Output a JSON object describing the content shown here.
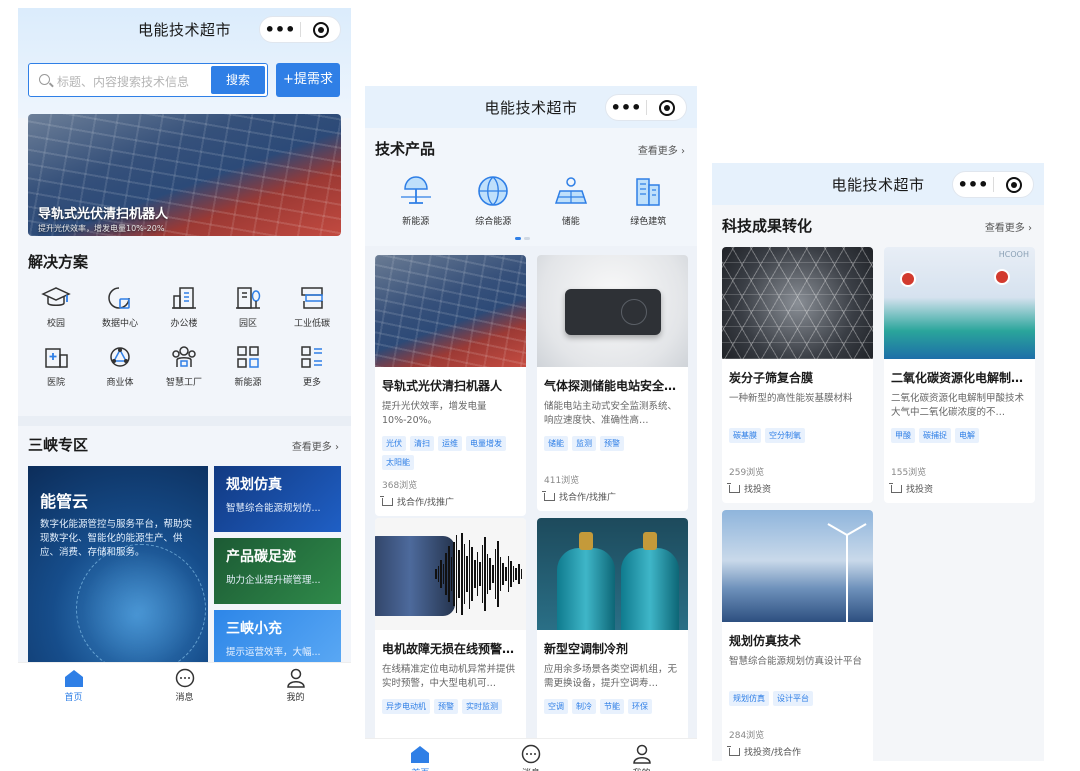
{
  "screens": [
    {
      "nav": {
        "title": "电能技术超市",
        "more": "•••"
      },
      "search": {
        "placeholder": "标题、内容搜索技术信息",
        "button": "搜索"
      },
      "request_button": "+提需求",
      "banner": {
        "title": "导轨式光伏清扫机器人",
        "subtitle": "提升光伏效率，增发电量10%-20%"
      },
      "solutions": {
        "title": "解决方案",
        "items": [
          {
            "label": "校园",
            "icon": "graduation-cap-icon"
          },
          {
            "label": "数据中心",
            "icon": "data-center-icon"
          },
          {
            "label": "办公楼",
            "icon": "office-building-icon"
          },
          {
            "label": "园区",
            "icon": "park-icon"
          },
          {
            "label": "工业低碳",
            "icon": "factory-icon"
          },
          {
            "label": "医院",
            "icon": "hospital-icon"
          },
          {
            "label": "商业体",
            "icon": "commercial-icon"
          },
          {
            "label": "智慧工厂",
            "icon": "smart-factory-icon"
          },
          {
            "label": "新能源",
            "icon": "grid-icon"
          },
          {
            "label": "更多",
            "icon": "more-list-icon"
          }
        ]
      },
      "zone": {
        "title": "三峡专区",
        "more": "查看更多",
        "big": {
          "title": "能管云",
          "desc": "数字化能源管控与服务平台，帮助实现数字化、智能化的能源生产、供应、消费、存储和服务。"
        },
        "small": [
          {
            "title": "规划仿真",
            "desc": "智慧综合能源规划仿..."
          },
          {
            "title": "产品碳足迹",
            "desc": "助力企业提升碳管理..."
          },
          {
            "title": "三峡小充",
            "desc": "提示运营效率，大幅..."
          }
        ]
      },
      "tabbar": [
        {
          "label": "首页",
          "icon": "home-icon"
        },
        {
          "label": "消息",
          "icon": "message-icon"
        },
        {
          "label": "我的",
          "icon": "user-icon"
        }
      ]
    },
    {
      "nav": {
        "title": "电能技术超市",
        "more": "•••"
      },
      "products": {
        "title": "技术产品",
        "more": "查看更多",
        "categories": [
          {
            "label": "新能源",
            "icon": "renewable-energy-icon"
          },
          {
            "label": "综合能源",
            "icon": "globe-icon"
          },
          {
            "label": "储能",
            "icon": "solar-panel-icon"
          },
          {
            "label": "绿色建筑",
            "icon": "green-building-icon"
          }
        ]
      },
      "cards": [
        {
          "title": "导轨式光伏清扫机器人",
          "desc": "提升光伏效率，增发电量10%-20%。",
          "tags": [
            "光伏",
            "清扫",
            "运维",
            "电量增发",
            "太阳能"
          ],
          "views": "368浏览",
          "action": "找合作/找推广"
        },
        {
          "title": "气体探测储能电站安全…",
          "desc": "储能电站主动式安全监测系统、响应速度快、准确性高…",
          "tags": [
            "储能",
            "监测",
            "预警"
          ],
          "views": "411浏览",
          "action": "找合作/找推广"
        },
        {
          "title": "电机故障无损在线预警…",
          "desc": "在线精准定位电动机异常并提供实时预警，中大型电机可…",
          "tags": [
            "异步电动机",
            "预警",
            "实时监测"
          ]
        },
        {
          "title": "新型空调制冷剂",
          "desc": "应用余多场景各类空调机组，无需更换设备，提升空调寿…",
          "tags": [
            "空调",
            "制冷",
            "节能",
            "环保"
          ]
        }
      ],
      "tabbar": [
        {
          "label": "首页",
          "icon": "home-icon"
        },
        {
          "label": "消息",
          "icon": "message-icon"
        },
        {
          "label": "我的",
          "icon": "user-icon"
        }
      ]
    },
    {
      "nav": {
        "title": "电能技术超市",
        "more": "•••"
      },
      "section": {
        "title": "科技成果转化",
        "more": "查看更多"
      },
      "cards": [
        {
          "title": "炭分子筛复合膜",
          "desc": "一种新型的高性能炭基膜材料",
          "tags": [
            "碳基膜",
            "空分制氧"
          ],
          "views": "259浏览",
          "action": "找投资"
        },
        {
          "title": "二氧化碳资源化电解制…",
          "desc": "二氧化碳资源化电解制甲酸技术大气中二氧化碳浓度的不…",
          "tags": [
            "甲酸",
            "碳捕捉",
            "电解"
          ],
          "views": "155浏览",
          "action": "找投资",
          "image_label": "HCOOH"
        },
        {
          "title": "规划仿真技术",
          "desc": "智慧综合能源规划仿真设计平台",
          "tags": [
            "规划仿真",
            "设计平台"
          ],
          "views": "284浏览",
          "action": "找投资/找合作"
        }
      ]
    }
  ],
  "colors": {
    "accent": "#2f7fe6",
    "nav_bg": "#e6f1fc",
    "tag_bg": "#e8f1fd"
  }
}
